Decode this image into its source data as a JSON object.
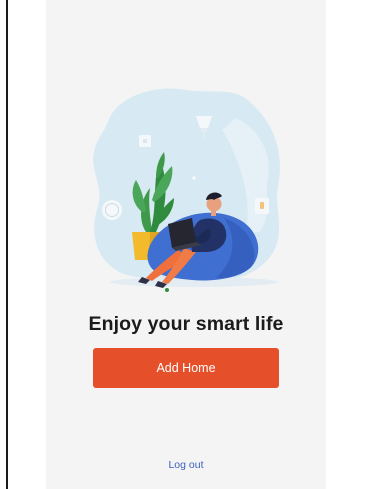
{
  "app": {
    "title": "Enjoy your smart life"
  },
  "actions": {
    "add_home_label": "Add Home",
    "logout_label": "Log out"
  },
  "colors": {
    "screen_background": "#f5f4f5",
    "primary_button": "#e5502a",
    "link": "#3a62b8",
    "title_text": "#1b1b1b"
  },
  "illustration": {
    "subject": "person-relaxing-with-laptop",
    "icons": [
      "thermostat-icon",
      "light-bulb-icon",
      "smart-plug-icon",
      "smart-speaker-icon",
      "smart-lamp-icon"
    ]
  }
}
